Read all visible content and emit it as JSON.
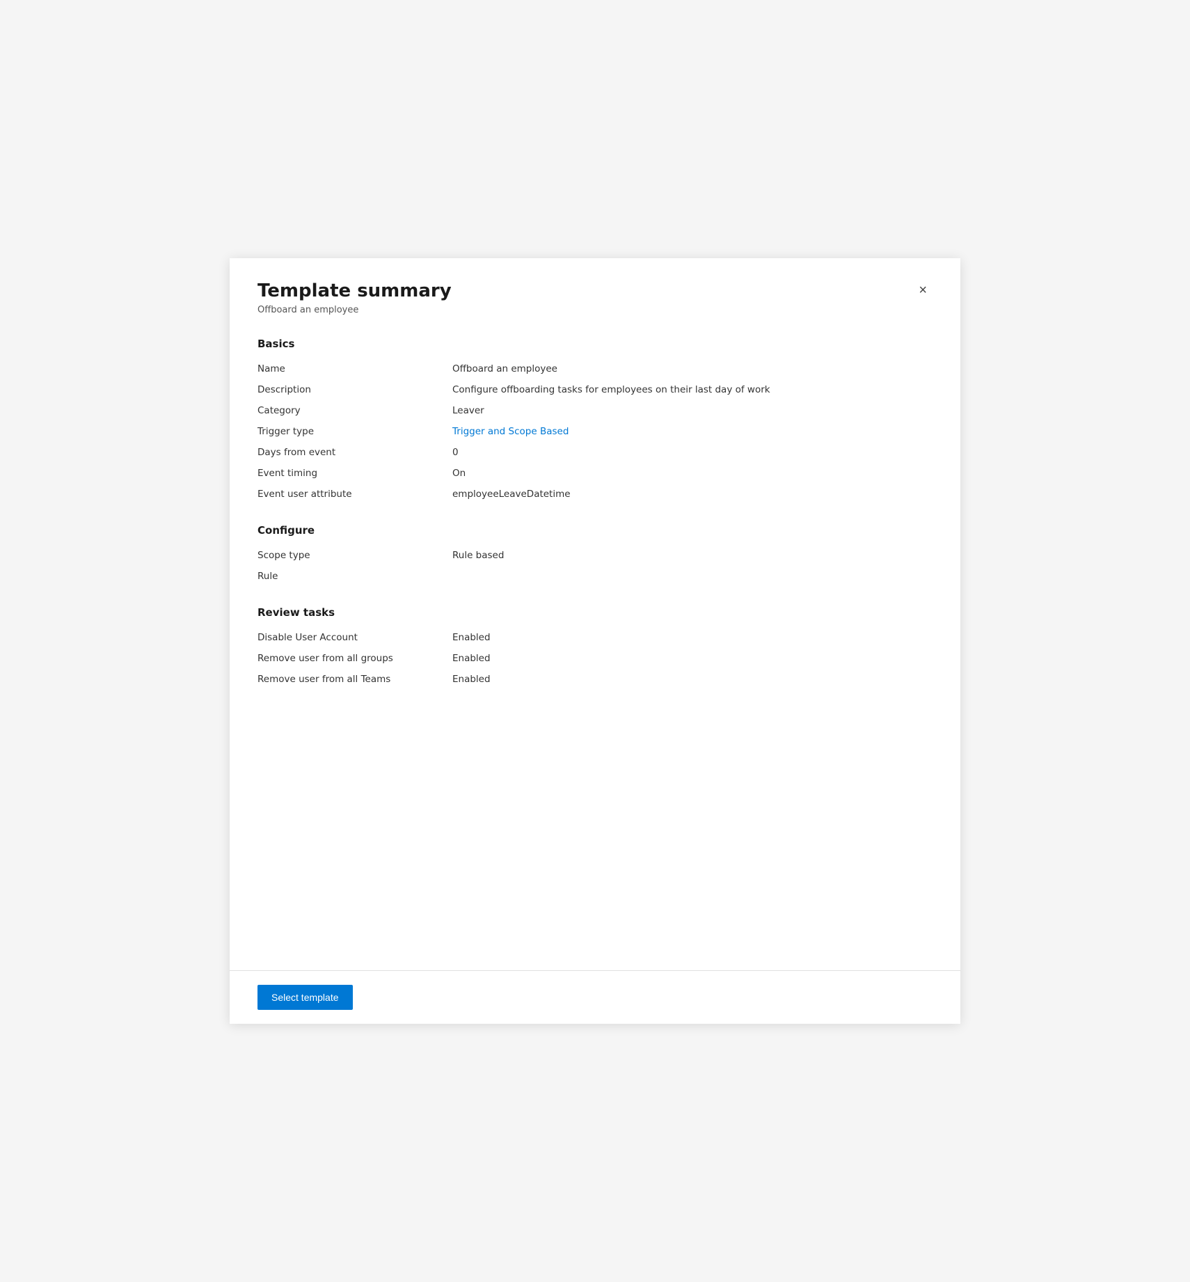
{
  "panel": {
    "title": "Template summary",
    "subtitle": "Offboard an employee",
    "close_label": "×"
  },
  "sections": {
    "basics": {
      "heading": "Basics",
      "fields": [
        {
          "label": "Name",
          "value": "Offboard an employee",
          "link": false
        },
        {
          "label": "Description",
          "value": "Configure offboarding tasks for employees on their last day of work",
          "link": false
        },
        {
          "label": "Category",
          "value": "Leaver",
          "link": false
        },
        {
          "label": "Trigger type",
          "value": "Trigger and Scope Based",
          "link": true
        },
        {
          "label": "Days from event",
          "value": "0",
          "link": false
        },
        {
          "label": "Event timing",
          "value": "On",
          "link": false
        },
        {
          "label": "Event user attribute",
          "value": "employeeLeaveDatetime",
          "link": false
        }
      ]
    },
    "configure": {
      "heading": "Configure",
      "fields": [
        {
          "label": "Scope type",
          "value": "Rule based",
          "link": false
        },
        {
          "label": "Rule",
          "value": "",
          "link": false
        }
      ]
    },
    "review_tasks": {
      "heading": "Review tasks",
      "fields": [
        {
          "label": "Disable User Account",
          "value": "Enabled",
          "link": true
        },
        {
          "label": "Remove user from all groups",
          "value": "Enabled",
          "link": true
        },
        {
          "label": "Remove user from all Teams",
          "value": "Enabled",
          "link": true
        }
      ]
    }
  },
  "footer": {
    "select_template_label": "Select template"
  }
}
